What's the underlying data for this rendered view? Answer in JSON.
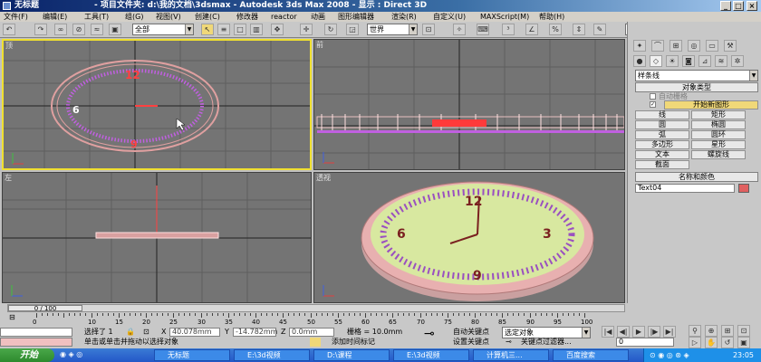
{
  "window": {
    "title": "无标题",
    "caption": "- 项目文件夹: d:\\我的文档\\3dsmax - Autodesk 3ds Max 2008 - 显示 : Direct 3D"
  },
  "menu": [
    "文件(F)",
    "编辑(E)",
    "工具(T)",
    "组(G)",
    "视图(V)",
    "创建(C)",
    "修改器",
    "reactor",
    "动画",
    "图形编辑器",
    "渲染(R)",
    "自定义(U)",
    "MAXScript(M)",
    "帮助(H)"
  ],
  "toolbar": {
    "selection_filter": "全部",
    "coord_system": "世界"
  },
  "viewports": {
    "top": "顶",
    "front": "前",
    "left": "左",
    "perspective": "透视"
  },
  "command_panel": {
    "category_dropdown": "样条线",
    "object_type_header": "对象类型",
    "auto_grid": "自动栅格",
    "start_new_shape": "开始新图形",
    "buttons": [
      "线",
      "矩形",
      "圆",
      "椭圆",
      "弧",
      "圆环",
      "多边形",
      "星形",
      "文本",
      "螺旋线",
      "截面"
    ],
    "name_color_header": "名称和颜色",
    "object_name": "Text04",
    "object_color": "#e06060"
  },
  "timeline": {
    "slider": "0 / 100",
    "ticks": [
      "0",
      "10",
      "15",
      "20",
      "25",
      "30",
      "35",
      "40",
      "45",
      "50",
      "55",
      "60",
      "65",
      "70",
      "75",
      "80",
      "85",
      "90",
      "95",
      "100"
    ]
  },
  "status": {
    "selected": "选择了 1",
    "x_label": "X",
    "x_value": "40.078mm",
    "y_label": "Y",
    "y_value": "-14.782mm",
    "z_label": "Z",
    "z_value": "0.0mm",
    "grid": "栅格 = 10.0mm",
    "prompt": "单击或单击并拖动以选择对象",
    "add_time_tag": "添加时间标记",
    "auto_key": "自动关键点",
    "set_key": "设置关键点",
    "selected_objects": "选定对象",
    "key_filters": "关键点过滤器...",
    "frame": "0"
  },
  "taskbar": {
    "start": "开始",
    "items": [
      "无标题",
      "E:\\3d视频",
      "D:\\课程",
      "E:\\3d视频",
      "计算机三...",
      "百度搜索"
    ],
    "clock": "23:05"
  }
}
